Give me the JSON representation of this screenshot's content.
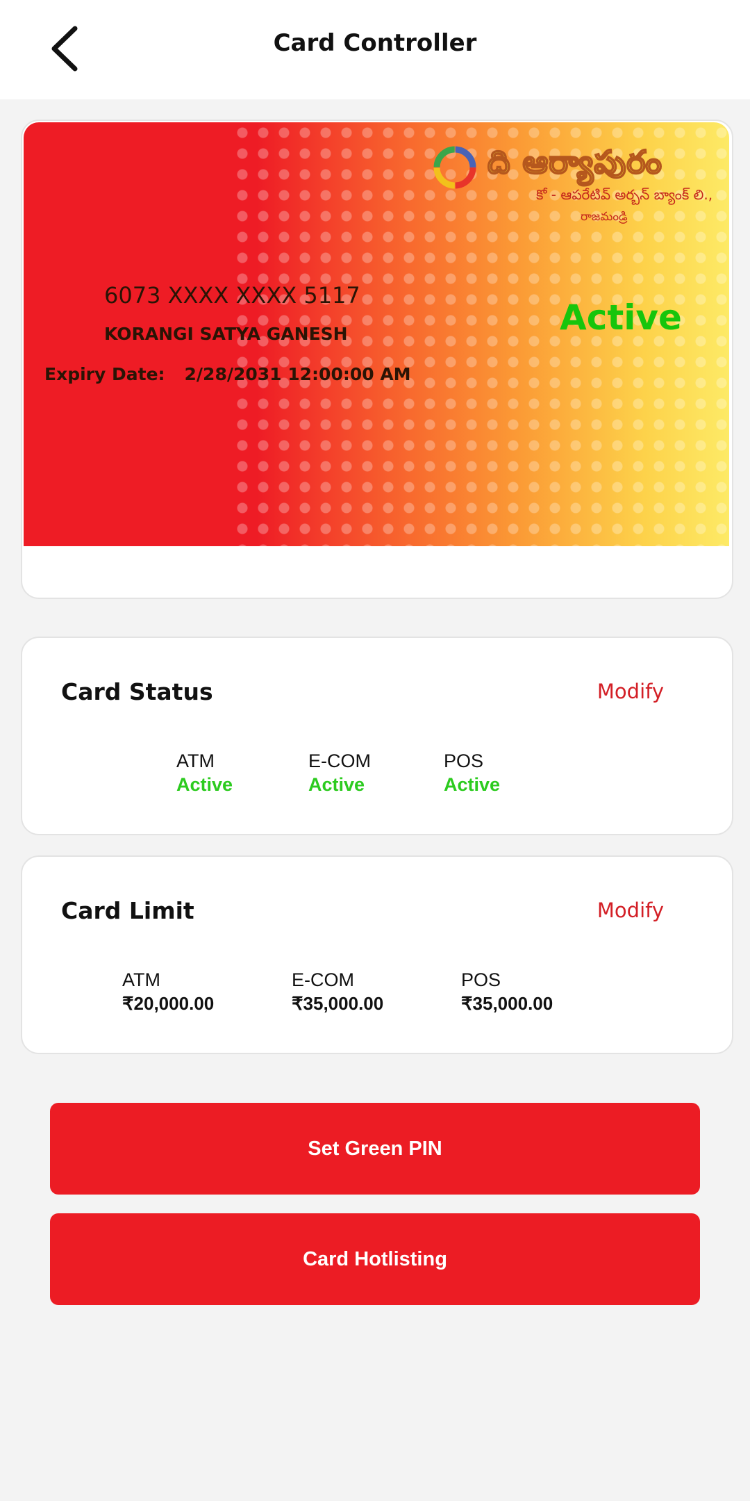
{
  "header": {
    "title": "Card Controller",
    "back_icon": "chevron-left-icon"
  },
  "card": {
    "bank_name": "ది ఆర్యాపురం",
    "bank_subtitle": "కో - ఆపరేటివ్ అర్బన్ బ్యాంక్ లి.,",
    "bank_city": "రాజమండ్రి",
    "number": "6073 XXXX XXXX 5117",
    "holder": "KORANGI SATYA GANESH",
    "expiry_label": "Expiry Date:",
    "expiry_value": "2/28/2031 12:00:00 AM",
    "status": "Active"
  },
  "card_status": {
    "title": "Card Status",
    "modify_label": "Modify",
    "items": [
      {
        "label": "ATM",
        "value": "Active"
      },
      {
        "label": "E-COM",
        "value": "Active"
      },
      {
        "label": "POS",
        "value": "Active"
      }
    ]
  },
  "card_limit": {
    "title": "Card Limit",
    "modify_label": "Modify",
    "items": [
      {
        "label": "ATM",
        "value": "₹20,000.00"
      },
      {
        "label": "E-COM",
        "value": "₹35,000.00"
      },
      {
        "label": "POS",
        "value": "₹35,000.00"
      }
    ]
  },
  "buttons": {
    "green_pin": "Set Green PIN",
    "hotlisting": "Card Hotlisting"
  },
  "colors": {
    "brand_red": "#ec1c24",
    "active_green": "#2ccb1f",
    "modify_red": "#d31f26"
  }
}
